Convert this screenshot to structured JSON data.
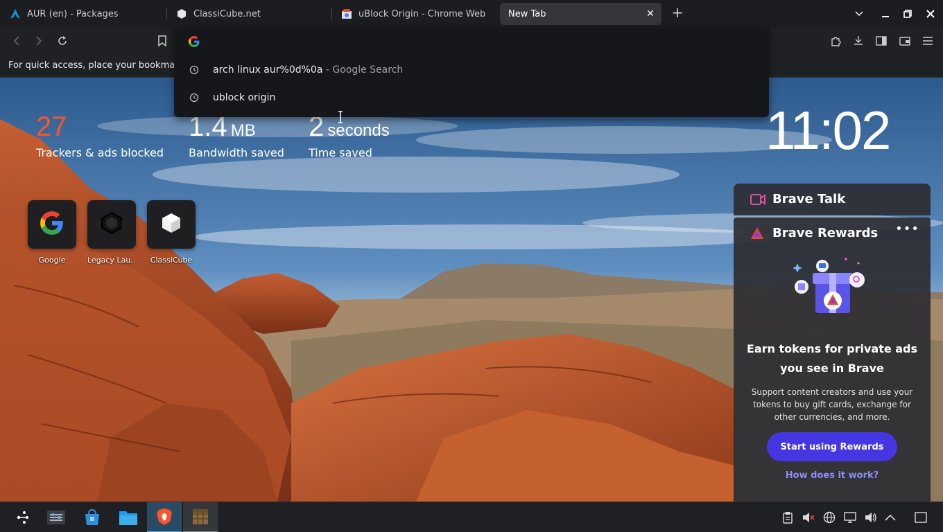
{
  "tabs": [
    {
      "title": "AUR (en) - Packages",
      "icon": "arch-linux-icon",
      "active": false
    },
    {
      "title": "ClassiCube.net",
      "icon": "cube-icon",
      "active": false
    },
    {
      "title": "uBlock Origin - Chrome Web Store",
      "icon": "chrome-web-store-icon",
      "active": false
    },
    {
      "title": "New Tab",
      "icon": "",
      "active": true
    }
  ],
  "bookmarks_bar": {
    "hint": "For quick access, place your bookmarks here on the bookmarks bar."
  },
  "omnibox": {
    "input_value": "",
    "suggestions": [
      {
        "text": "arch linux aur%0d%0a",
        "suffix": " - Google Search",
        "icon": "history-icon"
      },
      {
        "text": "ublock origin",
        "suffix": "",
        "icon": "history-icon"
      }
    ]
  },
  "stats": {
    "trackers": {
      "value": "27",
      "label": "Trackers & ads blocked",
      "color": "#fb542b"
    },
    "bandwidth": {
      "value": "1.4",
      "unit": "MB",
      "label": "Bandwidth saved"
    },
    "time": {
      "value": "2",
      "unit": "seconds",
      "label": "Time saved"
    }
  },
  "clock": "11:02",
  "top_sites": [
    {
      "name": "Google",
      "icon": "google-icon"
    },
    {
      "name": "Legacy Lau...",
      "icon": "legacy-launcher-icon"
    },
    {
      "name": "ClassiCube",
      "icon": "cube-icon"
    }
  ],
  "brave_talk": {
    "label": "Brave Talk"
  },
  "brave_rewards": {
    "title": "Brave Rewards",
    "headline": "Earn tokens for private ads you see in Brave",
    "body": "Support content creators and use your tokens to buy gift cards, exchange for other currencies, and more.",
    "button": "Start using Rewards",
    "link": "How does it work?",
    "accent": "#4436e1"
  },
  "taskbar": {
    "apps": [
      "application-launcher-icon",
      "system-settings-icon",
      "discover-store-icon",
      "dolphin-files-icon",
      "brave-browser-icon",
      "minecraft-icon"
    ]
  }
}
